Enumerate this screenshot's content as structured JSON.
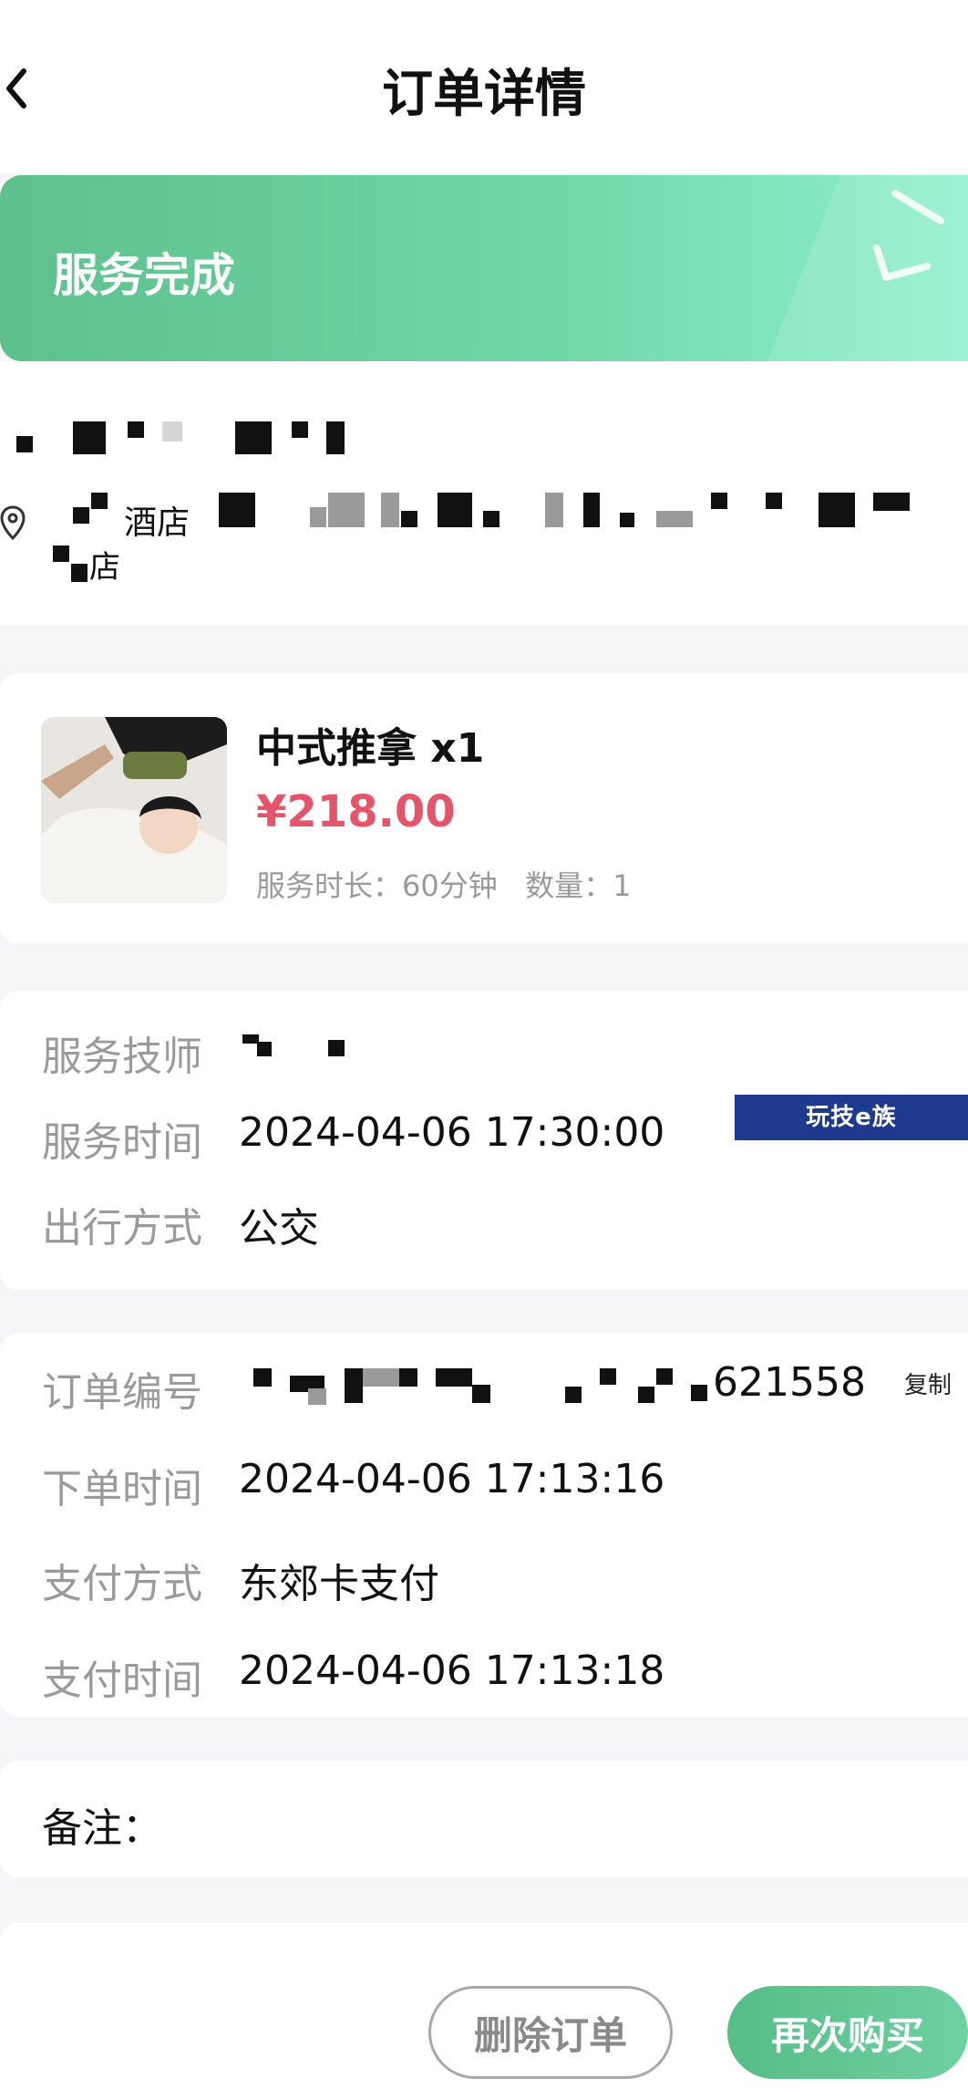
{
  "header": {
    "title": "订单详情",
    "back_icon": "chevron-left-icon"
  },
  "status": {
    "text": "服务完成",
    "color": "#5ec08d"
  },
  "address": {
    "hotel_word": "酒店",
    "store_suffix": "店",
    "pin_icon": "location-pin-icon"
  },
  "product": {
    "name": "中式推拿 x1",
    "price": "¥218.00",
    "meta": "服务时长：60分钟   数量：1",
    "price_color": "#e4546a"
  },
  "service": {
    "rows": [
      {
        "label": "服务技师",
        "value": ""
      },
      {
        "label": "服务时间",
        "value": "2024-04-06 17:30:00"
      },
      {
        "label": "出行方式",
        "value": "公交"
      }
    ],
    "ad_text": "玩技e族"
  },
  "order": {
    "rows": [
      {
        "label": "订单编号",
        "value": "621558"
      },
      {
        "label": "下单时间",
        "value": "2024-04-06 17:13:16"
      },
      {
        "label": "支付方式",
        "value": "东郊卡支付"
      },
      {
        "label": "支付时间",
        "value": "2024-04-06 17:13:18"
      }
    ],
    "copy_label": "复制"
  },
  "note": {
    "label": "备注："
  },
  "footer": {
    "delete_label": "删除订单",
    "buy_again_label": "再次购买"
  }
}
